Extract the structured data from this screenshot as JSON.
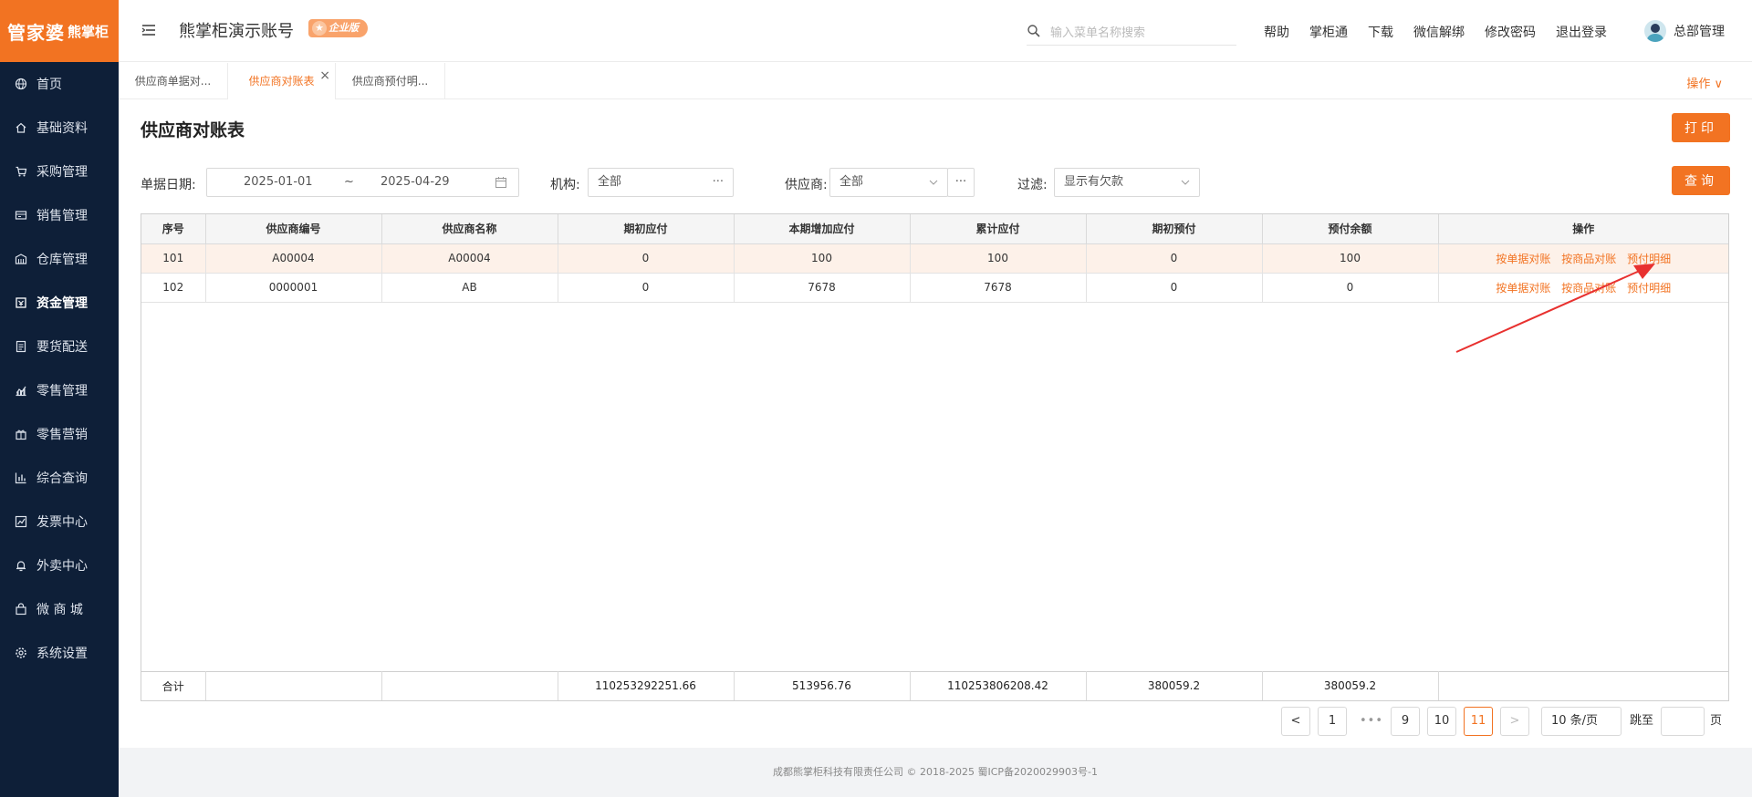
{
  "brand": {
    "logo_main": "管家婆",
    "logo_sub": "熊掌柜"
  },
  "sidebar": {
    "items": [
      {
        "label": "首页",
        "icon": "globe-icon"
      },
      {
        "label": "基础资料",
        "icon": "home-icon"
      },
      {
        "label": "采购管理",
        "icon": "cart-icon"
      },
      {
        "label": "销售管理",
        "icon": "register-icon"
      },
      {
        "label": "仓库管理",
        "icon": "warehouse-icon"
      },
      {
        "label": "资金管理",
        "icon": "wallet-icon",
        "active": true
      },
      {
        "label": "要货配送",
        "icon": "list-icon"
      },
      {
        "label": "零售管理",
        "icon": "chart-icon"
      },
      {
        "label": "零售营销",
        "icon": "gift-icon"
      },
      {
        "label": "综合查询",
        "icon": "bar-chart-icon"
      },
      {
        "label": "发票中心",
        "icon": "trend-icon"
      },
      {
        "label": "外卖中心",
        "icon": "bell-icon"
      },
      {
        "label": "微 商 城",
        "icon": "bag-icon"
      },
      {
        "label": "系统设置",
        "icon": "gear-icon"
      }
    ]
  },
  "header": {
    "account_title": "熊掌柜演示账号",
    "edition_badge": "企业版",
    "search_placeholder": "输入菜单名称搜索",
    "links": [
      "帮助",
      "掌柜通",
      "下载",
      "微信解绑",
      "修改密码",
      "退出登录"
    ],
    "user_name": "总部管理"
  },
  "tabs": {
    "items": [
      "供应商单据对...",
      "供应商对账表",
      "供应商预付明..."
    ],
    "active_index": 1,
    "close_glyph": "×",
    "operations_label": "操作 ∨"
  },
  "page": {
    "title": "供应商对账表",
    "print_label": "打印",
    "query_label": "查询"
  },
  "filters": {
    "date_label": "单据日期:",
    "date_from": "2025-01-01",
    "date_sep": "~",
    "date_to": "2025-04-29",
    "org_label": "机构:",
    "org_value": "全部",
    "supplier_label": "供应商:",
    "supplier_value": "全部",
    "filter_label": "过滤:",
    "filter_value": "显示有欠款",
    "more_glyph": "···"
  },
  "table": {
    "columns": [
      "序号",
      "供应商编号",
      "供应商名称",
      "期初应付",
      "本期增加应付",
      "累计应付",
      "期初预付",
      "预付余额",
      "操作"
    ],
    "rows": [
      {
        "seq": "101",
        "code": "A00004",
        "name": "A00004",
        "opening_payable": "0",
        "added_payable": "100",
        "cumulative_payable": "100",
        "opening_prepaid": "0",
        "prepaid_balance": "100"
      },
      {
        "seq": "102",
        "code": "0000001",
        "name": "AB",
        "opening_payable": "0",
        "added_payable": "7678",
        "cumulative_payable": "7678",
        "opening_prepaid": "0",
        "prepaid_balance": "0"
      }
    ],
    "actions": [
      "按单据对账",
      "按商品对账",
      "预付明细"
    ],
    "totals": {
      "label": "合计",
      "opening_payable": "110253292251.66",
      "added_payable": "513956.76",
      "cumulative_payable": "110253806208.42",
      "opening_prepaid": "380059.2",
      "prepaid_balance": "380059.2"
    }
  },
  "pagination": {
    "prev": "<",
    "next": ">",
    "pages": [
      "1",
      "9",
      "10",
      "11"
    ],
    "ellipsis": "•••",
    "current": "11",
    "page_size": "10 条/页",
    "jump_label": "跳至",
    "page_unit": "页"
  },
  "footer": {
    "text": "成都熊掌柜科技有限责任公司 © 2018-2025 蜀ICP备2020029903号-1"
  },
  "colors": {
    "accent": "#f27322",
    "sidebar": "#0e1f38",
    "highlight_row": "#fdf1e9",
    "annotation_arrow": "#e8312f"
  }
}
